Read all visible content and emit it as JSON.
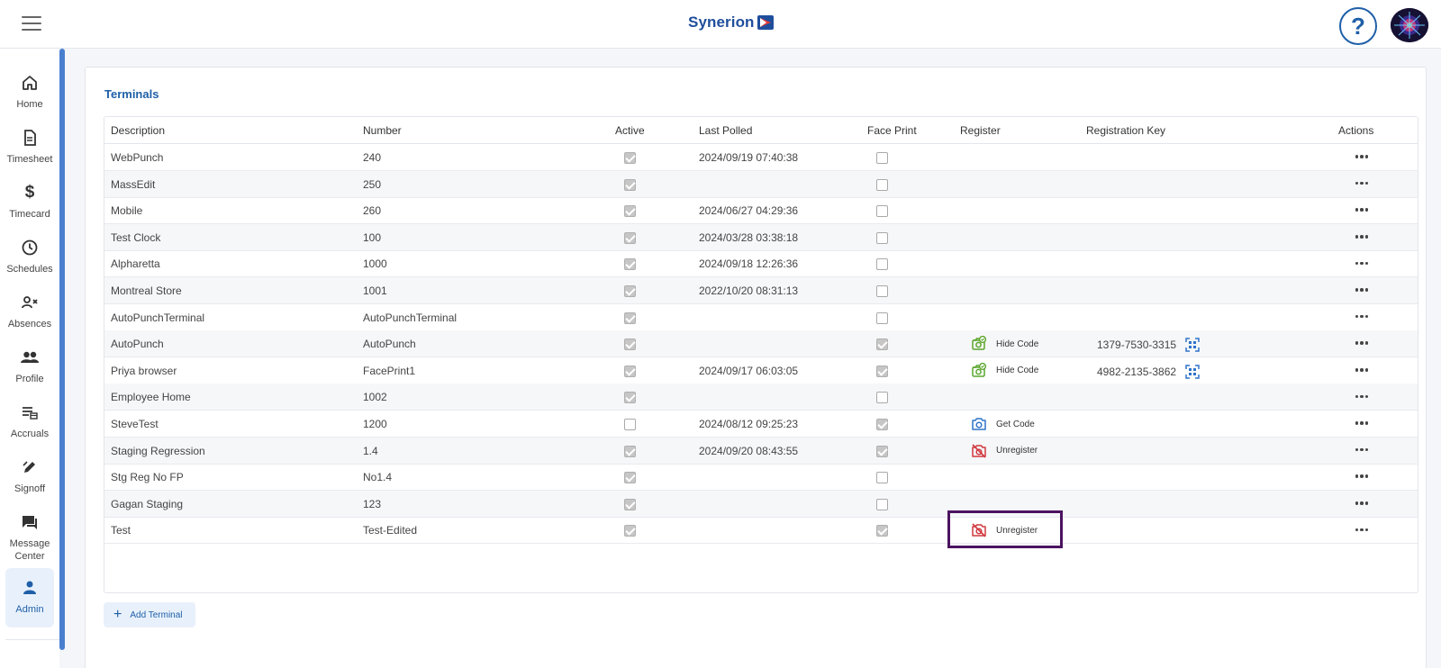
{
  "app": {
    "brand": "Synerion"
  },
  "header": {
    "help_symbol": "?"
  },
  "sidebar": {
    "items": [
      {
        "label": "Home",
        "icon": "home-icon"
      },
      {
        "label": "Timesheet",
        "icon": "document-icon"
      },
      {
        "label": "Timecard",
        "icon": "dollar-icon"
      },
      {
        "label": "Schedules",
        "icon": "clock-icon"
      },
      {
        "label": "Absences",
        "icon": "user-remove-icon"
      },
      {
        "label": "Profile",
        "icon": "people-icon"
      },
      {
        "label": "Accruals",
        "icon": "list-calendar-icon"
      },
      {
        "label": "Signoff",
        "icon": "pen-icon"
      },
      {
        "label": "Message Center",
        "icon": "chat-icon"
      },
      {
        "label": "Admin",
        "icon": "person-icon",
        "active": true
      }
    ]
  },
  "page": {
    "title": "Terminals",
    "add_button_label": "Add Terminal"
  },
  "table": {
    "columns": [
      "Description",
      "Number",
      "Active",
      "Last Polled",
      "Face Print",
      "Register",
      "Registration Key",
      "Actions"
    ],
    "rows": [
      {
        "description": "WebPunch",
        "number": "240",
        "active": true,
        "last_polled": "2024/09/19 07:40:38",
        "face_print": false,
        "register": "",
        "key": ""
      },
      {
        "description": "MassEdit",
        "number": "250",
        "active": true,
        "last_polled": "",
        "face_print": false,
        "register": "",
        "key": ""
      },
      {
        "description": "Mobile",
        "number": "260",
        "active": true,
        "last_polled": "2024/06/27 04:29:36",
        "face_print": false,
        "register": "",
        "key": ""
      },
      {
        "description": "Test Clock",
        "number": "100",
        "active": true,
        "last_polled": "2024/03/28 03:38:18",
        "face_print": false,
        "register": "",
        "key": ""
      },
      {
        "description": "Alpharetta",
        "number": "1000",
        "active": true,
        "last_polled": "2024/09/18 12:26:36",
        "face_print": false,
        "register": "",
        "key": ""
      },
      {
        "description": "Montreal Store",
        "number": "1001",
        "active": true,
        "last_polled": "2022/10/20 08:31:13",
        "face_print": false,
        "register": "",
        "key": ""
      },
      {
        "description": "AutoPunchTerminal",
        "number": "AutoPunchTerminal",
        "active": true,
        "last_polled": "",
        "face_print": false,
        "register": "",
        "key": ""
      },
      {
        "description": "AutoPunch",
        "number": "AutoPunch",
        "active": true,
        "last_polled": "",
        "face_print": true,
        "register": "Hide Code",
        "key": "1379-7530-3315"
      },
      {
        "description": "Priya browser",
        "number": "FacePrint1",
        "active": true,
        "last_polled": "2024/09/17 06:03:05",
        "face_print": true,
        "register": "Hide Code",
        "key": "4982-2135-3862"
      },
      {
        "description": "Employee Home",
        "number": "1002",
        "active": true,
        "last_polled": "",
        "face_print": false,
        "register": "",
        "key": ""
      },
      {
        "description": "SteveTest",
        "number": "1200",
        "active": false,
        "last_polled": "2024/08/12 09:25:23",
        "face_print": true,
        "register": "Get Code",
        "key": ""
      },
      {
        "description": "Staging Regression",
        "number": "1.4",
        "active": true,
        "last_polled": "2024/09/20 08:43:55",
        "face_print": true,
        "register": "Unregister",
        "key": ""
      },
      {
        "description": "Stg Reg No FP",
        "number": "No1.4",
        "active": true,
        "last_polled": "",
        "face_print": false,
        "register": "",
        "key": ""
      },
      {
        "description": "Gagan Staging",
        "number": "123",
        "active": true,
        "last_polled": "",
        "face_print": false,
        "register": "",
        "key": ""
      },
      {
        "description": "Test",
        "number": "Test-Edited",
        "active": true,
        "last_polled": "",
        "face_print": true,
        "register": "Unregister",
        "key": ""
      }
    ]
  },
  "colors": {
    "accent": "#1f5fa8",
    "register_green": "#5aa52c",
    "register_blue": "#2f73c9",
    "unregister_red": "#d0393f",
    "highlight": "#4b1360"
  }
}
